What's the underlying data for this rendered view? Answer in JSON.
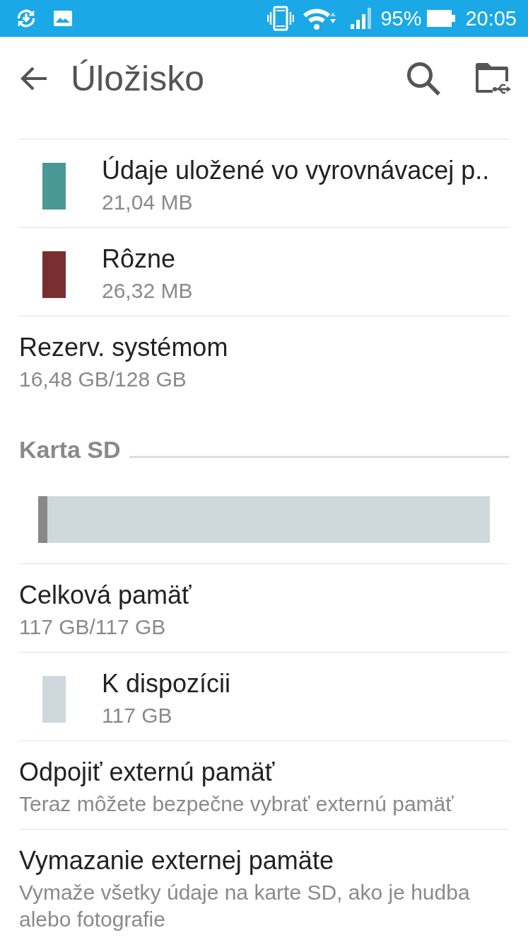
{
  "status_bar": {
    "battery": "95%",
    "time": "20:05"
  },
  "app_bar": {
    "title": "Úložisko"
  },
  "internal": {
    "items": [
      {
        "kind": "category",
        "title": "Údaje uložené vo vyrovnávacej p..",
        "subtitle": "21,04 MB",
        "color": "#4a9893"
      },
      {
        "kind": "category",
        "title": "Rôzne",
        "subtitle": "26,32 MB",
        "color": "#7a2e30"
      },
      {
        "kind": "plain",
        "title": "Rezerv. systémom",
        "subtitle": "16,48 GB/128 GB"
      }
    ]
  },
  "sd_card": {
    "header": "Karta SD",
    "usage_bar": {
      "level": 0.02
    },
    "items": [
      {
        "kind": "plain",
        "title": "Celková pamäť",
        "subtitle": "117 GB/117 GB"
      },
      {
        "kind": "category",
        "title": "K dispozícii",
        "subtitle": "117 GB",
        "color": "#cfd8dc"
      },
      {
        "kind": "plain",
        "title": "Odpojiť externú pamäť",
        "subtitle": "Teraz môžete bezpečne vybrať externú pamäť"
      },
      {
        "kind": "plain",
        "title": "Vymazanie externej pamäte",
        "subtitle": "Vymaže všetky údaje na karte SD, ako je hudba alebo fotografie"
      }
    ]
  }
}
